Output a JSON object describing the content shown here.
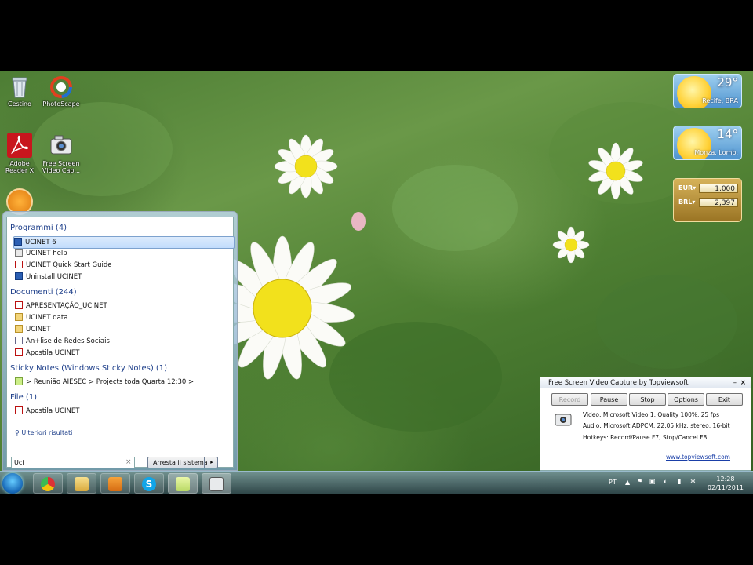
{
  "desktop_icons": [
    {
      "label": "Cestino",
      "icon": "recycle-bin-icon"
    },
    {
      "label": "PhotoScape",
      "icon": "photoscape-icon"
    },
    {
      "label": "Adobe Reader X",
      "icon": "adobe-reader-icon"
    },
    {
      "label": "Free Screen Video Cap...",
      "icon": "camera-icon"
    }
  ],
  "gadgets": {
    "weather": [
      {
        "temp": "29°",
        "city": "Recife, BRA"
      },
      {
        "temp": "14°",
        "city": "Monza, Lomb."
      }
    ],
    "currency": [
      {
        "code": "EUR",
        "value": "1,000"
      },
      {
        "code": "BRL",
        "value": "2,397"
      }
    ]
  },
  "start_menu": {
    "groups": [
      {
        "title": "Programmi (4)",
        "items": [
          {
            "label": "UCINET 6",
            "icon": "app",
            "selected": true
          },
          {
            "label": "UCINET help",
            "icon": "help"
          },
          {
            "label": "UCINET Quick Start Guide",
            "icon": "pdf"
          },
          {
            "label": "Uninstall UCINET",
            "icon": "app"
          }
        ]
      },
      {
        "title": "Documenti (244)",
        "items": [
          {
            "label": "APRESENTAÇÃO_UCINET",
            "icon": "pdf"
          },
          {
            "label": "UCINET data",
            "icon": "folder"
          },
          {
            "label": "UCINET",
            "icon": "folder"
          },
          {
            "label": "An+lise de Redes Sociais",
            "icon": "doc"
          },
          {
            "label": "Apostila UCINET",
            "icon": "pdf"
          }
        ]
      },
      {
        "title": "Sticky Notes (Windows Sticky Notes) (1)",
        "items": [
          {
            "label": "> Reunião AIESEC > Projects toda Quarta 12:30 >",
            "icon": "note"
          }
        ]
      },
      {
        "title": "File (1)",
        "items": [
          {
            "label": "Apostila UCINET",
            "icon": "pdf"
          }
        ]
      }
    ],
    "more_results": "Ulteriori risultati",
    "search_value": "Uci",
    "shutdown_label": "Arresta il sistema"
  },
  "capture_window": {
    "title": "Free Screen Video Capture by Topviewsoft",
    "buttons": [
      {
        "label": "Record",
        "disabled": true
      },
      {
        "label": "Pause",
        "disabled": false
      },
      {
        "label": "Stop",
        "disabled": false
      },
      {
        "label": "Options",
        "disabled": false
      },
      {
        "label": "Exit",
        "disabled": false
      }
    ],
    "video_line": "Video: Microsoft Video 1, Quality 100%, 25 fps",
    "audio_line": "Audio: Microsoft ADPCM, 22.05 kHz, stereo, 16-bit",
    "hotkeys_line": "Hotkeys: Record/Pause F7, Stop/Cancel F8",
    "link": "www.topviewsoft.com"
  },
  "taskbar": {
    "pinned": [
      "chrome-icon",
      "explorer-icon",
      "media-player-icon",
      "skype-icon",
      "sticky-notes-icon",
      "camera-icon"
    ],
    "language": "PT",
    "time": "12:28",
    "date": "02/11/2011"
  }
}
